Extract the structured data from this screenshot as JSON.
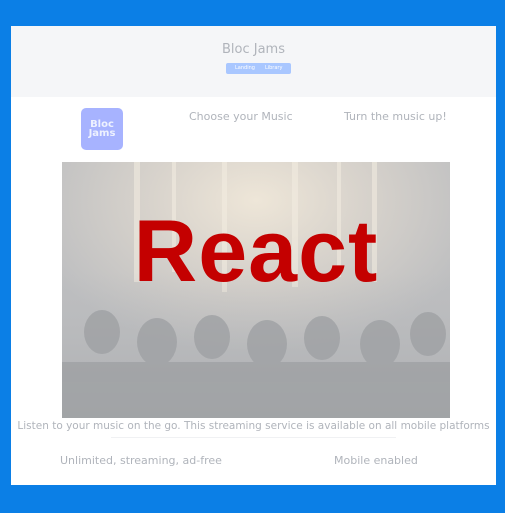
{
  "header": {
    "title": "Bloc Jams",
    "nav": [
      {
        "label": "Landing"
      },
      {
        "label": "Library"
      }
    ]
  },
  "logo": {
    "line1": "Bloc",
    "line2": "Jams"
  },
  "features_top": [
    {
      "label": "Choose your Music"
    },
    {
      "label": "Turn the music up!"
    }
  ],
  "hero": {
    "overlay_text": "React",
    "text_color": "#c40000"
  },
  "tagline": "Listen to your music on the go. This streaming service is available on all mobile platforms",
  "features_bottom": [
    {
      "label": "Unlimited, streaming, ad-free"
    },
    {
      "label": "Mobile enabled"
    }
  ],
  "colors": {
    "background": "#0b7fe6",
    "panel": "#ffffff",
    "header": "#f5f6f8",
    "nav": "#a9c7ff",
    "logo": "#a7b3ff",
    "muted_text": "#b0b4bb"
  }
}
